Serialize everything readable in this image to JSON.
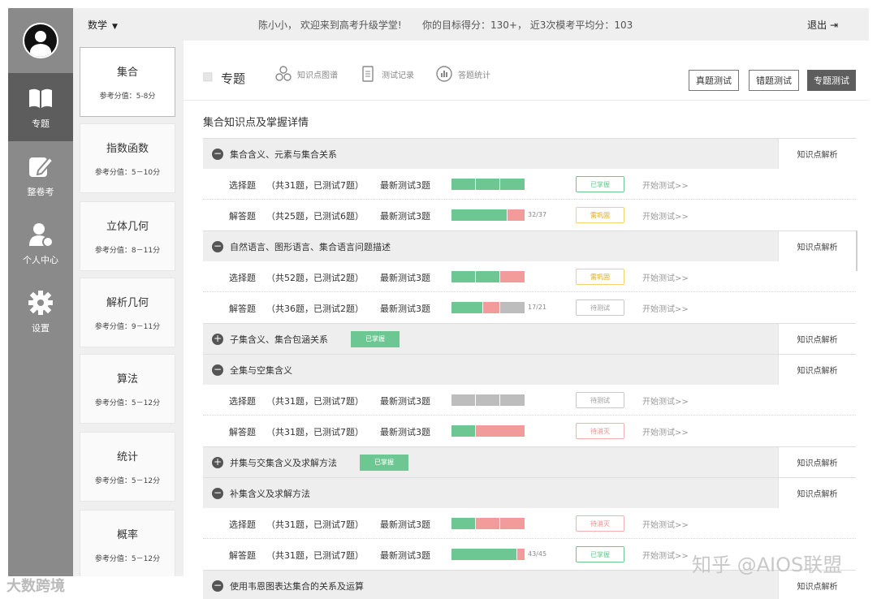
{
  "colors": {
    "mastered": "#6cc792",
    "weak": "#f29b9b",
    "untested": "#bdbdbd",
    "status_green_border": "#6cc792",
    "status_yellow_border": "#f3d36b",
    "status_red_border": "#f3b0b0",
    "status_gray_border": "#c8c8c8"
  },
  "nav": {
    "avatar_icon": "user-avatar-icon",
    "items": [
      {
        "label": "专题",
        "icon": "book-icon"
      },
      {
        "label": "整卷考",
        "icon": "edit-icon"
      },
      {
        "label": "个人中心",
        "icon": "person-icon"
      },
      {
        "label": "设置",
        "icon": "gear-icon"
      }
    ]
  },
  "topbar": {
    "subject": "数学",
    "greeting": "陈小小， 欢迎来到高考升级学堂!",
    "target": "你的目标得分：130+， 近3次模考平均分：103",
    "logout": "退出"
  },
  "topics": [
    {
      "title": "集合",
      "score": "参考分值：5-8分"
    },
    {
      "title": "指数函数",
      "score": "参考分值：5－10分"
    },
    {
      "title": "立体几何",
      "score": "参考分值：8－11分"
    },
    {
      "title": "解析几何",
      "score": "参考分值：9－11分"
    },
    {
      "title": "算法",
      "score": "参考分值：5－12分"
    },
    {
      "title": "统计",
      "score": "参考分值：5－12分"
    },
    {
      "title": "概率",
      "score": "参考分值：5－12分"
    }
  ],
  "header": {
    "tabs": [
      {
        "label": "专题",
        "icon": "topic-icon"
      },
      {
        "label": "知识点图谱",
        "icon": "graph-icon"
      },
      {
        "label": "测试记录",
        "icon": "record-icon"
      },
      {
        "label": "答题统计",
        "icon": "stats-icon"
      }
    ],
    "buttons": [
      "真题测试",
      "错题测试",
      "专题测试"
    ]
  },
  "section_title": "集合知识点及掌握详情",
  "analysis_label": "知识点解析",
  "start_label": "开始测试>>",
  "latest_label": "最新测试3题",
  "groups": [
    {
      "sign": "−",
      "title": "集合含义、元素与集合关系",
      "rows": [
        {
          "type": "选择题",
          "count": "（共31题，已测试7题）",
          "bar": [
            {
              "color": "green",
              "value": 1
            },
            {
              "color": "green",
              "value": 1
            },
            {
              "color": "green",
              "value": 1
            }
          ],
          "frac": "",
          "status": "已掌握",
          "status_color": "green"
        },
        {
          "type": "解答题",
          "count": "（共25题，已测试6题）",
          "bar": [
            {
              "color": "green",
              "value": 2.3
            },
            {
              "color": "red",
              "value": 0.7
            }
          ],
          "frac": "32/37",
          "status": "需巩固",
          "status_color": "yellow"
        }
      ]
    },
    {
      "sign": "−",
      "title": "自然语言、图形语言、集合语言问题描述",
      "rows": [
        {
          "type": "选择题",
          "count": "（共52题，已测试2题）",
          "bar": [
            {
              "color": "green",
              "value": 1
            },
            {
              "color": "green",
              "value": 1
            },
            {
              "color": "red",
              "value": 1
            }
          ],
          "frac": "",
          "status": "需巩固",
          "status_color": "yellow"
        },
        {
          "type": "解答题",
          "count": "（共36题，已测试2题）",
          "bar": [
            {
              "color": "green",
              "value": 1.3
            },
            {
              "color": "red",
              "value": 0.7
            },
            {
              "color": "gray",
              "value": 1
            }
          ],
          "frac": "17/21",
          "status": "待测试",
          "status_color": "gray"
        }
      ]
    },
    {
      "sign": "+",
      "title": "子集含义、集合包涵关系",
      "badge": "已掌握",
      "rows": []
    },
    {
      "sign": "−",
      "title": "全集与空集含义",
      "rows": [
        {
          "type": "选择题",
          "count": "（共31题，已测试7题）",
          "bar": [
            {
              "color": "gray",
              "value": 1
            },
            {
              "color": "gray",
              "value": 1
            },
            {
              "color": "gray",
              "value": 1
            }
          ],
          "frac": "",
          "status": "待测试",
          "status_color": "gray"
        },
        {
          "type": "解答题",
          "count": "（共31题，已测试7题）",
          "bar": [
            {
              "color": "green",
              "value": 1
            },
            {
              "color": "red",
              "value": 2
            }
          ],
          "frac": "",
          "status": "待消灭",
          "status_color": "red"
        }
      ]
    },
    {
      "sign": "+",
      "title": "并集与交集含义及求解方法",
      "badge": "已掌握",
      "rows": []
    },
    {
      "sign": "−",
      "title": "补集含义及求解方法",
      "rows": [
        {
          "type": "选择题",
          "count": "（共31题，已测试7题）",
          "bar": [
            {
              "color": "green",
              "value": 1
            },
            {
              "color": "red",
              "value": 1
            },
            {
              "color": "red",
              "value": 1
            }
          ],
          "frac": "",
          "status": "待消灭",
          "status_color": "red"
        },
        {
          "type": "解答题",
          "count": "（共31题，已测试7题）",
          "bar": [
            {
              "color": "green",
              "value": 2.7
            },
            {
              "color": "red",
              "value": 0.3
            }
          ],
          "frac": "43/45",
          "status": "已掌握",
          "status_color": "green"
        }
      ]
    },
    {
      "sign": "−",
      "title": "使用韦恩图表达集合的关系及运算",
      "rows": []
    }
  ],
  "watermarks": {
    "left": "大数跨境",
    "right": "知乎 @AIOS联盟"
  }
}
